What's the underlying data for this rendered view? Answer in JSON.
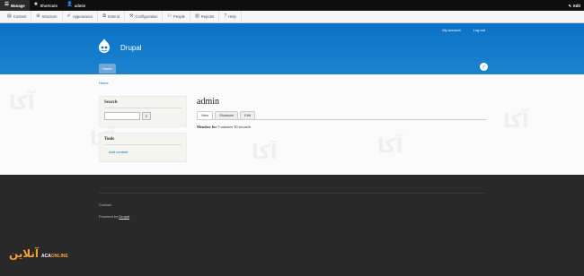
{
  "toolbar": {
    "manage": "Manage",
    "shortcuts": "Shortcuts",
    "user": "admin",
    "edit": "Edit",
    "tray": [
      "Content",
      "Structure",
      "Appearance",
      "Extend",
      "Configuration",
      "People",
      "Reports",
      "Help"
    ]
  },
  "header": {
    "my_account": "My account",
    "logout": "Log out",
    "site_name": "Drupal",
    "main_menu_home": "Home"
  },
  "content": {
    "breadcrumb": "Home",
    "search_title": "Search",
    "tools_title": "Tools",
    "tools_link": "Add content",
    "page_title": "admin",
    "tabs": [
      "View",
      "Shortcuts",
      "Edit"
    ],
    "member_label": "Member for",
    "member_value": "5 minutes 30 seconds",
    "watermark": "آکا"
  },
  "footer": {
    "contact": "Contact",
    "powered_by": "Powered by",
    "powered_link": "Drupal"
  },
  "brand": {
    "fa": "آنلاین",
    "en_prefix": "ACA",
    "en_suffix": "ONLINE"
  },
  "colors": {
    "header_blue": "#0b72c6",
    "link": "#0071b3",
    "footer": "#292929",
    "brand_accent": "#f0a030"
  }
}
